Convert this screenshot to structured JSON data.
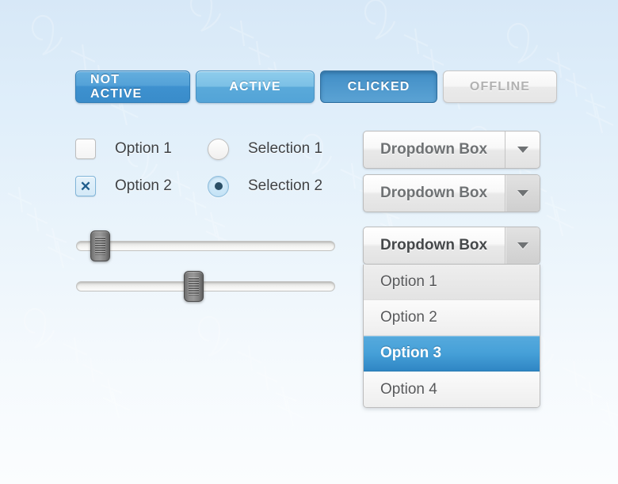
{
  "theme": {
    "accent_blue": "#3e91cf",
    "accent_blue_light": "#7cc0e6",
    "accent_blue_dark": "#2f86c4",
    "selected_row_blue": "#46a0d8",
    "disabled_gray": "#b2b2b2",
    "text_gray": "#58595b",
    "label_gray": "#3f4245",
    "bg_top": "#d7e8f7",
    "bg_bottom": "#fbfdfe"
  },
  "buttons": [
    {
      "label": "NOT ACTIVE",
      "state": "not-active"
    },
    {
      "label": "ACTIVE",
      "state": "active"
    },
    {
      "label": "CLICKED",
      "state": "clicked"
    },
    {
      "label": "OFFLINE",
      "state": "offline"
    }
  ],
  "checkboxes": [
    {
      "label": "Option 1",
      "checked": false,
      "mark": ""
    },
    {
      "label": "Option 2",
      "checked": true,
      "mark": "✕"
    }
  ],
  "radios": [
    {
      "label": "Selection 1",
      "selected": false
    },
    {
      "label": "Selection 2",
      "selected": true
    }
  ],
  "sliders": [
    {
      "name": "slider-1",
      "value_percent": 6
    },
    {
      "name": "slider-2",
      "value_percent": 45
    }
  ],
  "dropdowns": {
    "closed": [
      {
        "label": "Dropdown Box",
        "arrow": "chevron-down-icon",
        "arrow_style": "plain"
      },
      {
        "label": "Dropdown Box",
        "arrow": "chevron-down-icon",
        "arrow_style": "shaded"
      }
    ],
    "open": {
      "label": "Dropdown Box",
      "arrow": "chevron-down-icon",
      "items": [
        {
          "label": "Option 1",
          "selected": false
        },
        {
          "label": "Option 2",
          "selected": false
        },
        {
          "label": "Option 3",
          "selected": true
        },
        {
          "label": "Option 4",
          "selected": false
        }
      ]
    }
  }
}
